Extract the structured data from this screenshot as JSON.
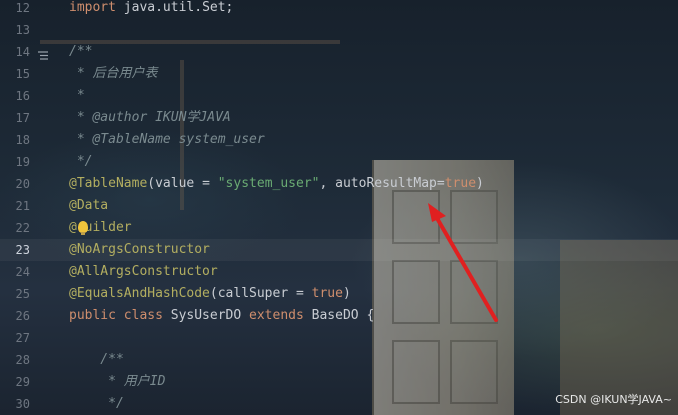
{
  "editor": {
    "lines": [
      {
        "num": "12",
        "tokens": [
          {
            "t": "import ",
            "c": "kw"
          },
          {
            "t": "java.util.Set;",
            "c": "plain"
          }
        ]
      },
      {
        "num": "13",
        "tokens": []
      },
      {
        "num": "14",
        "tokens": [
          {
            "t": "/**",
            "c": "comment"
          }
        ],
        "fold": true
      },
      {
        "num": "15",
        "tokens": [
          {
            "t": " * 后台用户表",
            "c": "comment"
          }
        ]
      },
      {
        "num": "16",
        "tokens": [
          {
            "t": " *",
            "c": "comment"
          }
        ]
      },
      {
        "num": "17",
        "tokens": [
          {
            "t": " * ",
            "c": "comment"
          },
          {
            "t": "@author",
            "c": "doctag"
          },
          {
            "t": " IKUN学JAVA",
            "c": "comment"
          }
        ]
      },
      {
        "num": "18",
        "tokens": [
          {
            "t": " * ",
            "c": "comment"
          },
          {
            "t": "@TableName",
            "c": "doctag"
          },
          {
            "t": " system_user",
            "c": "comment"
          }
        ]
      },
      {
        "num": "19",
        "tokens": [
          {
            "t": " */",
            "c": "comment"
          }
        ]
      },
      {
        "num": "20",
        "tokens": [
          {
            "t": "@TableName",
            "c": "ann"
          },
          {
            "t": "(value = ",
            "c": "plain"
          },
          {
            "t": "\"system_user\"",
            "c": "str"
          },
          {
            "t": ", autoResultMap=",
            "c": "plain"
          },
          {
            "t": "true",
            "c": "kw"
          },
          {
            "t": ")",
            "c": "plain"
          }
        ]
      },
      {
        "num": "21",
        "tokens": [
          {
            "t": "@Data",
            "c": "ann"
          }
        ]
      },
      {
        "num": "22",
        "tokens": [
          {
            "t": "@",
            "c": "ann"
          },
          {
            "t": " ",
            "c": "plain"
          },
          {
            "t": "uilder",
            "c": "ann"
          }
        ],
        "bulb": true
      },
      {
        "num": "23",
        "tokens": [
          {
            "t": "@NoArgsConstructor",
            "c": "ann"
          }
        ],
        "current": true
      },
      {
        "num": "24",
        "tokens": [
          {
            "t": "@AllArgsConstructor",
            "c": "ann"
          }
        ]
      },
      {
        "num": "25",
        "tokens": [
          {
            "t": "@EqualsAndHashCode",
            "c": "ann"
          },
          {
            "t": "(callSuper = ",
            "c": "plain"
          },
          {
            "t": "true",
            "c": "kw"
          },
          {
            "t": ")",
            "c": "plain"
          }
        ]
      },
      {
        "num": "26",
        "tokens": [
          {
            "t": "public class ",
            "c": "kw"
          },
          {
            "t": "SysUserDO ",
            "c": "plain"
          },
          {
            "t": "extends ",
            "c": "kw"
          },
          {
            "t": "BaseDO {",
            "c": "plain"
          }
        ]
      },
      {
        "num": "27",
        "tokens": []
      },
      {
        "num": "28",
        "tokens": [
          {
            "t": "    /**",
            "c": "comment"
          }
        ]
      },
      {
        "num": "29",
        "tokens": [
          {
            "t": "     * 用户ID",
            "c": "comment"
          }
        ]
      },
      {
        "num": "30",
        "tokens": [
          {
            "t": "     */",
            "c": "comment"
          }
        ]
      }
    ]
  },
  "colors": {
    "arrow": "#e02020"
  },
  "watermark": "CSDN @IKUN学JAVA~"
}
